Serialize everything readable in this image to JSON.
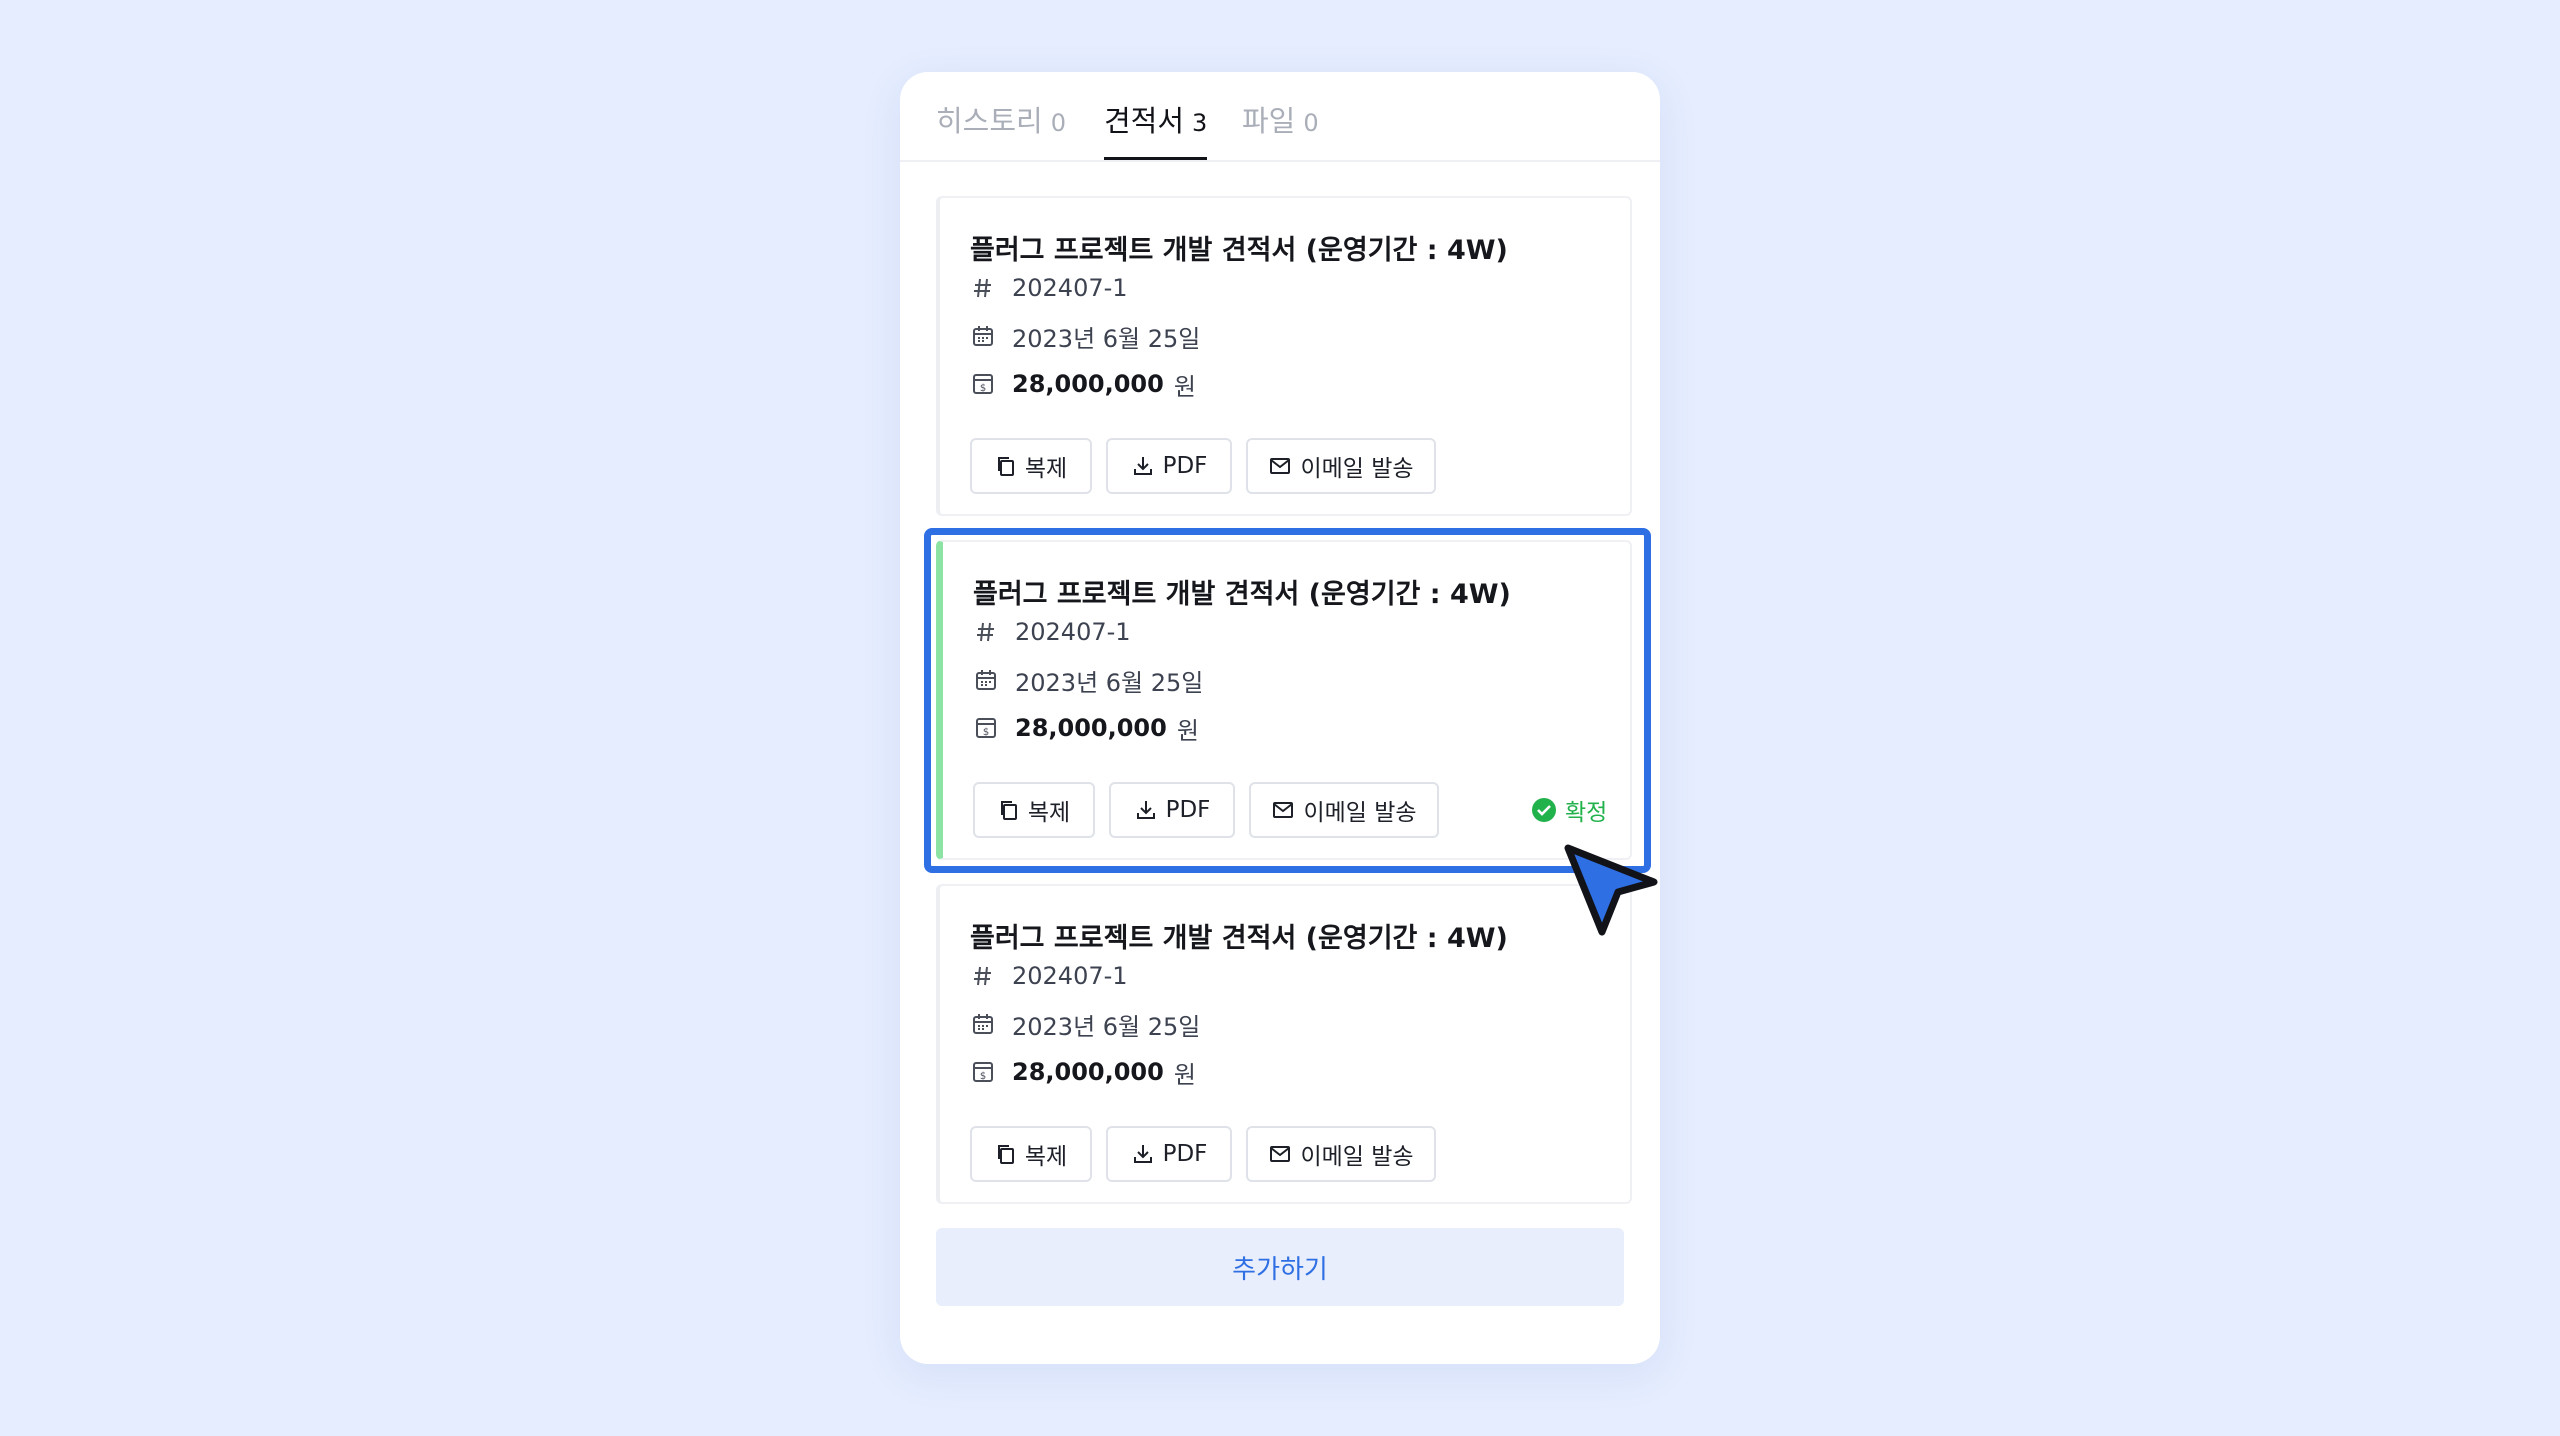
{
  "tabs": [
    {
      "label": "히스토리",
      "count": "0"
    },
    {
      "label": "견적서",
      "count": "3"
    },
    {
      "label": "파일",
      "count": "0"
    }
  ],
  "quotes": [
    {
      "title": "플러그 프로젝트 개발 견적서 (운영기간 : 4W)",
      "number": "202407-1",
      "date": "2023년 6월 25일",
      "amount": "28,000,000",
      "currency": "원",
      "status": ""
    },
    {
      "title": "플러그 프로젝트 개발 견적서 (운영기간 : 4W)",
      "number": "202407-1",
      "date": "2023년 6월 25일",
      "amount": "28,000,000",
      "currency": "원",
      "status": "확정"
    },
    {
      "title": "플러그 프로젝트 개발 견적서 (운영기간 : 4W)",
      "number": "202407-1",
      "date": "2023년 6월 25일",
      "amount": "28,000,000",
      "currency": "원",
      "status": ""
    }
  ],
  "actions": {
    "duplicate": "복제",
    "pdf": "PDF",
    "email": "이메일 발송"
  },
  "add_button": "추가하기",
  "icons": {
    "number": "hash-icon",
    "date": "calendar-icon",
    "amount": "receipt-icon",
    "duplicate": "copy-icon",
    "pdf": "download-icon",
    "email": "mail-icon",
    "status": "check-circle-icon",
    "pointer": "cursor-arrow-icon"
  },
  "colors": {
    "background": "#e5edfe",
    "accent": "#2f6fe4",
    "confirmed": "#22b24c",
    "selected_bar": "#8de3a3",
    "add_button_bg": "#e8eefc"
  }
}
